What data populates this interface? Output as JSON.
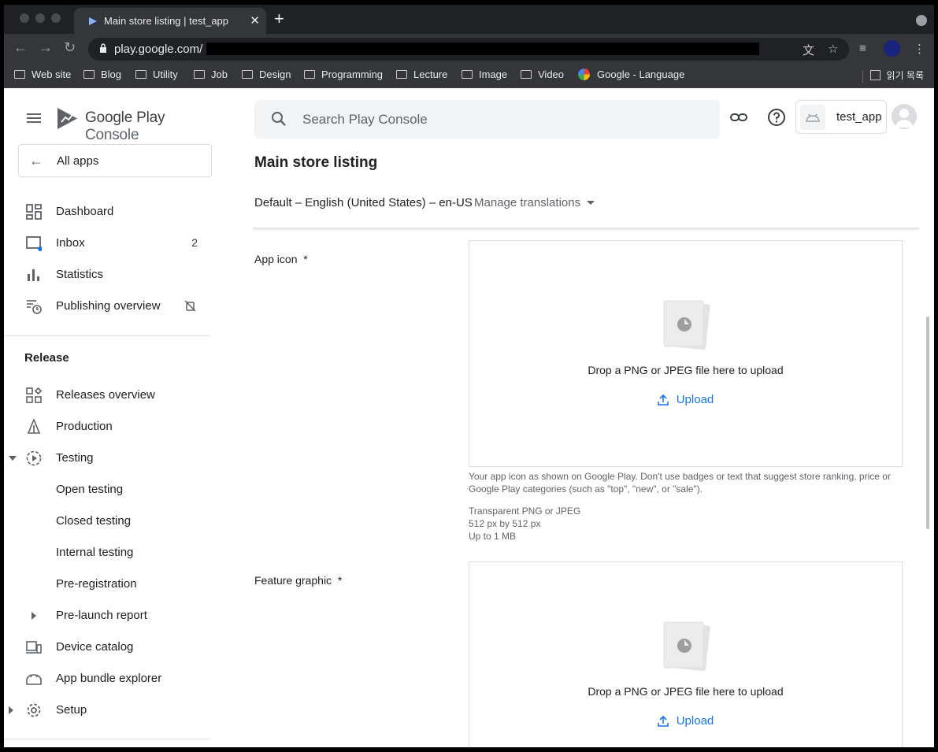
{
  "browser": {
    "tab_title": "Main store listing | test_app",
    "url": "play.google.com/",
    "bookmarks": [
      "Web site",
      "Blog",
      "Utility",
      "Job",
      "Design",
      "Programming",
      "Lecture",
      "Image",
      "Video"
    ],
    "google_bookmark": "Google - Language",
    "reading_list": "읽기 목록"
  },
  "header": {
    "logo_prefix": "Google Play",
    "logo_suffix": "Console",
    "search_placeholder": "Search Play Console",
    "app_name": "test_app"
  },
  "sidebar": {
    "all_apps": "All apps",
    "top_items": [
      {
        "label": "Dashboard",
        "icon": "dashboard-icon"
      },
      {
        "label": "Inbox",
        "icon": "inbox-icon",
        "badge": "2"
      },
      {
        "label": "Statistics",
        "icon": "bar-chart-icon"
      },
      {
        "label": "Publishing overview",
        "icon": "schedule-list-icon"
      }
    ],
    "release_heading": "Release",
    "release_items": [
      {
        "label": "Releases overview",
        "icon": "releases-grid-icon"
      },
      {
        "label": "Production",
        "icon": "production-icon"
      },
      {
        "label": "Testing",
        "icon": "testing-icon"
      },
      {
        "label": "Open testing"
      },
      {
        "label": "Closed testing"
      },
      {
        "label": "Internal testing"
      },
      {
        "label": "Pre-registration"
      },
      {
        "label": "Pre-launch report"
      },
      {
        "label": "Device catalog",
        "icon": "devices-icon"
      },
      {
        "label": "App bundle explorer",
        "icon": "android-bundle-icon"
      },
      {
        "label": "Setup",
        "icon": "settings-gear-icon"
      }
    ]
  },
  "main": {
    "title": "Main store listing",
    "language": "Default – English (United States) – en-US",
    "manage_translations": "Manage translations",
    "app_icon": {
      "label": "App icon",
      "required": "*",
      "drop_text": "Drop a PNG or JPEG file here to upload",
      "upload": "Upload",
      "help1": "Your app icon as shown on Google Play. Don't use badges or text that suggest store ranking, price or Google Play categories (such as \"top\", \"new\", or \"sale\").",
      "spec1": "Transparent PNG or JPEG",
      "spec2": "512 px by 512 px",
      "spec3": "Up to 1 MB"
    },
    "feature_graphic": {
      "label": "Feature graphic",
      "required": "*",
      "drop_text": "Drop a PNG or JPEG file here to upload",
      "upload": "Upload"
    }
  },
  "colors": {
    "accent": "#1a73e8",
    "text": "#202124",
    "muted": "#5f6368",
    "border": "#dadce0"
  }
}
